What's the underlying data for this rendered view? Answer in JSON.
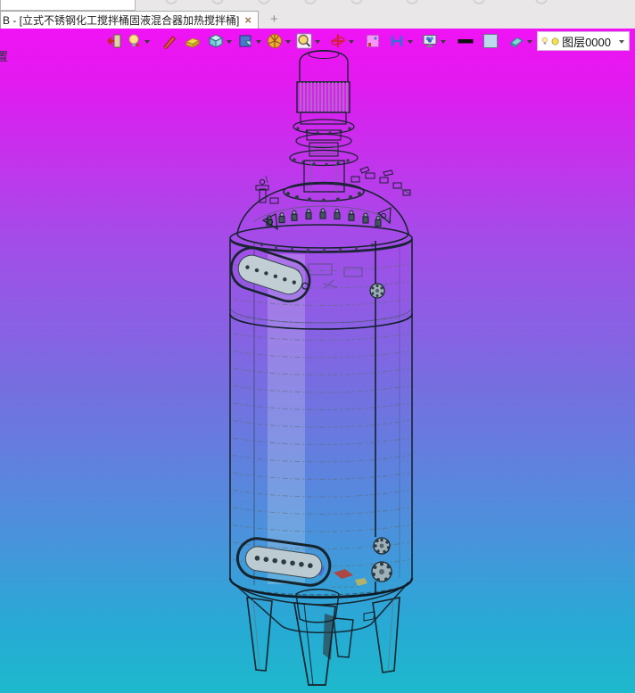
{
  "tab_bar": {
    "active_tab": {
      "title": "B - [立式不锈钢化工搅拌桶固液混合器加热搅拌桶]",
      "close_glyph": "×"
    },
    "new_tab_glyph": "+"
  },
  "edge": {
    "clipped_glyph": "置"
  },
  "toolbar": {
    "items": [
      {
        "name": "exit-door-icon",
        "dropdown": false
      },
      {
        "name": "lamp-icon",
        "dropdown": true
      },
      {
        "name": "pencil-sketch-icon",
        "dropdown": false
      },
      {
        "name": "surface-box-icon",
        "dropdown": false
      },
      {
        "name": "solid-cube-icon",
        "dropdown": true
      },
      {
        "name": "sheet-feature-icon",
        "dropdown": true
      },
      {
        "name": "pie-pattern-icon",
        "dropdown": true
      },
      {
        "name": "magnifier-zoom-icon",
        "dropdown": true
      },
      {
        "name": "crosshair-move-icon",
        "dropdown": true
      },
      {
        "name": "selection-frame-icon",
        "dropdown": false
      },
      {
        "name": "h-section-icon",
        "dropdown": true
      },
      {
        "name": "monitor-render-icon",
        "dropdown": true
      },
      {
        "name": "line-width-swatch",
        "dropdown": false
      },
      {
        "name": "color-swatch",
        "dropdown": false
      },
      {
        "name": "eraser-wedge-icon",
        "dropdown": true
      }
    ],
    "layer_selector": {
      "value": "图层0000"
    }
  },
  "colors": {
    "bg_top": "#f013f4",
    "bg_m1": "#a849e9",
    "bg_m2": "#7470e0",
    "bg_m3": "#4b92dc",
    "bg_bottom": "#1db9cc",
    "tank_fill": "#b6c7ce",
    "tank_line": "#16242d"
  }
}
